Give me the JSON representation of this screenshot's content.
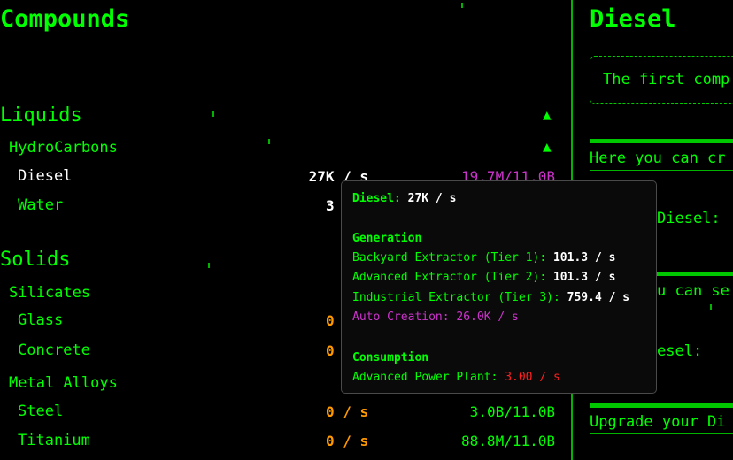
{
  "left": {
    "title": "Compounds",
    "liquids": {
      "label": "Liquids",
      "arrow": "▲",
      "hydrocarbons": {
        "label": "HydroCarbons",
        "arrow": "▲"
      },
      "items": [
        {
          "name": "Diesel",
          "rate": "27K / s",
          "amount": "19.7M/11.0B"
        },
        {
          "name": "Water",
          "rate": "3",
          "amount": ""
        }
      ]
    },
    "solids": {
      "label": "Solids",
      "silicates": {
        "label": "Silicates",
        "items": [
          {
            "name": "Glass",
            "rate": "0",
            "amount": ""
          },
          {
            "name": "Concrete",
            "rate": "0",
            "amount": ""
          }
        ]
      },
      "metal_alloys": {
        "label": "Metal Alloys",
        "items": [
          {
            "name": "Steel",
            "rate": "0 / s",
            "amount": "3.0B/11.0B"
          },
          {
            "name": "Titanium",
            "rate": "0 / s",
            "amount": "88.8M/11.0B"
          }
        ]
      }
    }
  },
  "right": {
    "title": "Diesel",
    "info": "The first comp",
    "section1": "Here you can cr",
    "label1": "Diesel:",
    "section2": "u can se",
    "label2": "esel:",
    "section3": "Upgrade your Di"
  },
  "tooltip": {
    "name": "Diesel:",
    "rate": "27K / s",
    "generation_title": "Generation",
    "generation": [
      {
        "label": "Backyard Extractor (Tier 1):",
        "value": "101.3 / s"
      },
      {
        "label": "Advanced Extractor (Tier 2):",
        "value": "101.3 / s"
      },
      {
        "label": "Industrial Extractor (Tier 3):",
        "value": "759.4 / s"
      }
    ],
    "auto_creation": "Auto Creation: 26.0K / s",
    "consumption_title": "Consumption",
    "consumption_label": "Advanced Power Plant:",
    "consumption_value": "3.00 / s"
  },
  "colors": {
    "text": "#00ff00",
    "value_white": "#ffffff",
    "orange": "#ff9900",
    "magenta": "#cc33cc",
    "red": "#ff2020",
    "background": "#000000"
  }
}
